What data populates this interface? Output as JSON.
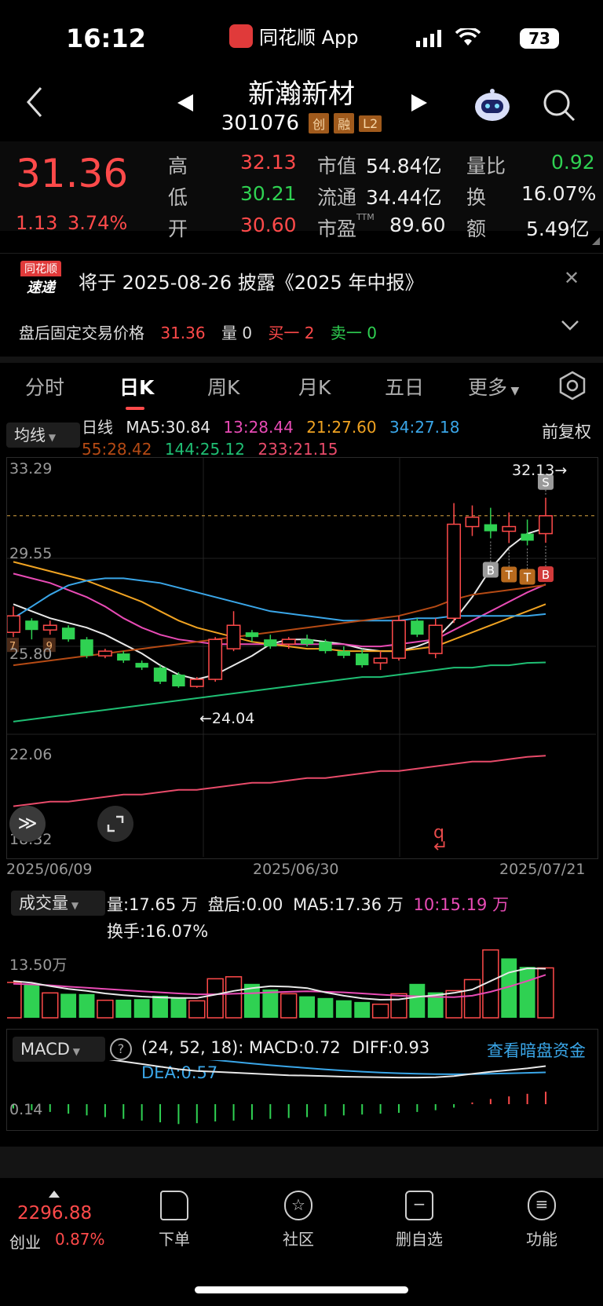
{
  "status": {
    "time": "16:12",
    "app_name": "同花顺 App",
    "battery": "73"
  },
  "header": {
    "name": "新瀚新材",
    "code": "301076",
    "tags": [
      "创",
      "融",
      "L2"
    ]
  },
  "quote": {
    "price": "31.36",
    "change": "1.13",
    "change_pct": "3.74%",
    "high_label": "高",
    "high": "32.13",
    "low_label": "低",
    "low": "30.21",
    "open_label": "开",
    "open": "30.60",
    "mcap_label": "市值",
    "mcap": "54.84亿",
    "float_label": "流通",
    "float": "34.44亿",
    "pe_label": "市盈",
    "pe_sup": "TTM",
    "pe": "89.60",
    "vr_label": "量比",
    "vr": "0.92",
    "turnover_label": "换",
    "turnover": "16.07%",
    "amount_label": "额",
    "amount": "5.49亿"
  },
  "news": {
    "badge_top": "同花顺",
    "badge_bottom": "速递",
    "text": "将于 2025-08-26 披露《2025 年中报》"
  },
  "afterhours": {
    "label": "盘后固定交易价格",
    "price": "31.36",
    "vol_label": "量",
    "vol": "0",
    "buy_label": "买一",
    "buy": "2",
    "sell_label": "卖一",
    "sell": "0"
  },
  "tabs": [
    "分时",
    "日K",
    "周K",
    "月K",
    "五日",
    "更多"
  ],
  "ma_bar": {
    "selector": "均线",
    "line_type": "日线",
    "adjust": "前复权",
    "ma": [
      {
        "label": "MA5:30.84",
        "color": "#e8e8e8"
      },
      {
        "label": "13:28.44",
        "color": "#e84bb5"
      },
      {
        "label": "21:27.60",
        "color": "#f0a322"
      },
      {
        "label": "34:27.18",
        "color": "#3aa6e8"
      },
      {
        "label": "55:28.42",
        "color": "#b54a14"
      },
      {
        "label": "144:25.12",
        "color": "#1fbf74"
      },
      {
        "label": "233:21.15",
        "color": "#e84b6a"
      }
    ]
  },
  "chart_data": [
    {
      "type": "candlestick",
      "title": "日K",
      "y_ticks": [
        "33.29",
        "29.55",
        "25.80",
        "22.06",
        "18.32"
      ],
      "ylim": [
        18.32,
        33.29
      ],
      "x_labels": [
        "2025/06/09",
        "2025/06/30",
        "2025/07/21"
      ],
      "annotations": {
        "high": "32.13→",
        "low": "←24.04",
        "dashed_price": 31.36
      },
      "candles": [
        {
          "o": 26.4,
          "c": 27.1,
          "h": 27.5,
          "l": 26.2
        },
        {
          "o": 26.9,
          "c": 26.5,
          "h": 27.0,
          "l": 26.1
        },
        {
          "o": 26.5,
          "c": 26.7,
          "h": 26.9,
          "l": 26.3
        },
        {
          "o": 26.6,
          "c": 26.1,
          "h": 26.7,
          "l": 26.0
        },
        {
          "o": 26.1,
          "c": 25.4,
          "h": 26.2,
          "l": 25.3
        },
        {
          "o": 25.4,
          "c": 25.6,
          "h": 25.7,
          "l": 25.3
        },
        {
          "o": 25.5,
          "c": 25.2,
          "h": 25.6,
          "l": 25.1
        },
        {
          "o": 25.1,
          "c": 24.9,
          "h": 25.2,
          "l": 24.8
        },
        {
          "o": 24.9,
          "c": 24.3,
          "h": 25.0,
          "l": 24.2
        },
        {
          "o": 24.6,
          "c": 24.1,
          "h": 24.7,
          "l": 24.04
        },
        {
          "o": 24.1,
          "c": 24.4,
          "h": 24.5,
          "l": 24.04
        },
        {
          "o": 24.4,
          "c": 26.1,
          "h": 26.2,
          "l": 24.3
        },
        {
          "o": 25.7,
          "c": 26.7,
          "h": 27.3,
          "l": 25.6
        },
        {
          "o": 26.4,
          "c": 26.2,
          "h": 26.5,
          "l": 26.0
        },
        {
          "o": 26.1,
          "c": 25.8,
          "h": 26.3,
          "l": 25.7
        },
        {
          "o": 25.9,
          "c": 26.1,
          "h": 26.2,
          "l": 25.7
        },
        {
          "o": 26.1,
          "c": 25.9,
          "h": 26.3,
          "l": 25.8
        },
        {
          "o": 26.0,
          "c": 25.6,
          "h": 26.1,
          "l": 25.5
        },
        {
          "o": 25.6,
          "c": 25.4,
          "h": 25.8,
          "l": 25.3
        },
        {
          "o": 25.5,
          "c": 25.0,
          "h": 25.7,
          "l": 24.9
        },
        {
          "o": 25.1,
          "c": 25.3,
          "h": 25.6,
          "l": 24.8
        },
        {
          "o": 25.3,
          "c": 26.9,
          "h": 27.1,
          "l": 25.2
        },
        {
          "o": 26.9,
          "c": 26.3,
          "h": 27.0,
          "l": 26.2
        },
        {
          "o": 25.5,
          "c": 26.7,
          "h": 27.0,
          "l": 25.3
        },
        {
          "o": 27.0,
          "c": 31.0,
          "h": 31.9,
          "l": 26.8
        },
        {
          "o": 30.9,
          "c": 31.3,
          "h": 31.8,
          "l": 30.5
        },
        {
          "o": 31.0,
          "c": 30.7,
          "h": 31.7,
          "l": 30.4
        },
        {
          "o": 30.7,
          "c": 30.9,
          "h": 31.5,
          "l": 30.2
        },
        {
          "o": 30.6,
          "c": 30.3,
          "h": 31.2,
          "l": 30.1
        },
        {
          "o": 30.6,
          "c": 31.36,
          "h": 32.13,
          "l": 30.21
        }
      ],
      "ma_lines": {
        "ma5": {
          "color": "#e8e8e8",
          "values": [
            27.6,
            27.3,
            27.0,
            26.8,
            26.6,
            26.3,
            25.9,
            25.5,
            25.0,
            24.6,
            24.4,
            24.6,
            25.0,
            25.4,
            25.9,
            26.1,
            26.1,
            26.0,
            25.9,
            25.7,
            25.6,
            25.6,
            25.8,
            26.1,
            26.9,
            27.9,
            29.1,
            30.0,
            30.6,
            30.84
          ]
        },
        "ma13": {
          "color": "#e84bb5",
          "values": [
            28.9,
            28.7,
            28.5,
            28.2,
            27.9,
            27.5,
            27.0,
            26.6,
            26.3,
            26.1,
            26.0,
            25.9,
            25.9,
            25.9,
            25.9,
            25.9,
            25.9,
            25.9,
            25.9,
            25.8,
            25.8,
            25.9,
            26.0,
            26.1,
            26.5,
            26.9,
            27.3,
            27.7,
            28.1,
            28.44
          ]
        },
        "ma21": {
          "color": "#f0a322",
          "values": [
            29.4,
            29.2,
            29.0,
            28.8,
            28.6,
            28.3,
            28.0,
            27.7,
            27.3,
            26.9,
            26.6,
            26.4,
            26.2,
            26.0,
            25.9,
            25.8,
            25.7,
            25.7,
            25.6,
            25.6,
            25.6,
            25.6,
            25.7,
            25.8,
            26.1,
            26.4,
            26.7,
            27.0,
            27.3,
            27.6
          ]
        },
        "ma34": {
          "color": "#3aa6e8",
          "values": [
            27.0,
            27.5,
            28.0,
            28.4,
            28.6,
            28.7,
            28.7,
            28.6,
            28.5,
            28.3,
            28.1,
            27.9,
            27.7,
            27.5,
            27.3,
            27.2,
            27.1,
            27.0,
            26.9,
            26.9,
            26.9,
            26.9,
            27.0,
            27.0,
            27.1,
            27.1,
            27.1,
            27.1,
            27.1,
            27.18
          ]
        },
        "ma55": {
          "color": "#b54a14",
          "values": [
            25.0,
            25.1,
            25.2,
            25.3,
            25.4,
            25.5,
            25.6,
            25.7,
            25.8,
            25.9,
            26.0,
            26.1,
            26.2,
            26.3,
            26.4,
            26.5,
            26.6,
            26.7,
            26.8,
            26.9,
            27.0,
            27.1,
            27.3,
            27.5,
            27.8,
            28.0,
            28.1,
            28.2,
            28.3,
            28.42
          ]
        },
        "ma144": {
          "color": "#1fbf74",
          "values": [
            22.6,
            22.7,
            22.8,
            22.9,
            23.0,
            23.1,
            23.2,
            23.3,
            23.4,
            23.5,
            23.6,
            23.7,
            23.8,
            23.9,
            24.0,
            24.1,
            24.2,
            24.3,
            24.4,
            24.5,
            24.5,
            24.6,
            24.7,
            24.8,
            24.9,
            24.9,
            25.0,
            25.0,
            25.1,
            25.12
          ]
        },
        "ma233": {
          "color": "#e84b6a",
          "values": [
            19.0,
            19.1,
            19.2,
            19.2,
            19.3,
            19.4,
            19.5,
            19.5,
            19.6,
            19.7,
            19.7,
            19.8,
            19.9,
            20.0,
            20.0,
            20.1,
            20.2,
            20.2,
            20.3,
            20.4,
            20.5,
            20.5,
            20.6,
            20.7,
            20.8,
            20.9,
            20.9,
            21.0,
            21.1,
            21.15
          ]
        }
      },
      "signals": [
        {
          "i": 26,
          "label": "B",
          "color": "#9a9a9a"
        },
        {
          "i": 27,
          "label": "T",
          "color": "#b86a1e"
        },
        {
          "i": 28,
          "label": "T",
          "color": "#b86a1e"
        },
        {
          "i": 29,
          "label": "B",
          "color": "#d23a3a"
        },
        {
          "i": 29,
          "label": "S",
          "color": "#9a9a9a",
          "above": true
        }
      ],
      "left_markers": [
        "7",
        "9"
      ]
    },
    {
      "type": "bar",
      "title": "成交量",
      "info": {
        "vol": "量:17.65 万",
        "after": "盘后:0.00",
        "ma5": "MA5:17.36 万",
        "ma10": "10:15.19 万",
        "turnover": "换手:16.07%"
      },
      "y_ticks": [
        "13.50万"
      ],
      "values": [
        12.5,
        12.0,
        8.8,
        8.5,
        8.4,
        6.2,
        6.4,
        6.6,
        7.8,
        7.2,
        6.0,
        13.8,
        14.5,
        12.0,
        10.0,
        8.5,
        7.6,
        7.0,
        6.2,
        5.6,
        4.8,
        8.5,
        12.0,
        9.0,
        9.6,
        13.5,
        24.0,
        21.0,
        18.0,
        17.65
      ],
      "up": [
        true,
        false,
        true,
        false,
        false,
        true,
        false,
        false,
        false,
        false,
        true,
        true,
        true,
        false,
        false,
        true,
        false,
        false,
        false,
        false,
        true,
        true,
        false,
        false,
        true,
        true,
        true,
        false,
        false,
        true
      ],
      "ma5": [
        13.0,
        12.4,
        11.2,
        10.2,
        9.5,
        8.6,
        8.0,
        7.5,
        7.2,
        7.0,
        7.0,
        8.2,
        9.5,
        10.5,
        11.2,
        11.0,
        10.5,
        9.0,
        7.8,
        6.9,
        6.4,
        6.5,
        7.4,
        8.0,
        8.8,
        10.0,
        13.0,
        16.0,
        17.5,
        17.36
      ],
      "ma10": [
        12.0,
        11.8,
        11.5,
        11.0,
        10.6,
        10.2,
        9.8,
        9.4,
        9.0,
        8.6,
        8.3,
        8.3,
        8.5,
        8.7,
        9.0,
        9.2,
        9.4,
        9.2,
        9.0,
        8.6,
        8.2,
        7.8,
        7.6,
        7.4,
        7.3,
        7.8,
        9.2,
        11.0,
        13.0,
        15.19
      ]
    },
    {
      "type": "macd",
      "title": "MACD",
      "params": "(24, 52, 18): MACD:0.72",
      "diff": "DIFF:0.93",
      "dea": "DEA:0.57",
      "y_ticks": [
        "0.14"
      ],
      "hist": [
        -0.25,
        -0.35,
        -0.45,
        -0.55,
        -0.65,
        -0.75,
        -0.85,
        -0.95,
        -1.05,
        -1.15,
        -1.1,
        -1.0,
        -0.95,
        -0.9,
        -0.85,
        -0.8,
        -0.75,
        -0.7,
        -0.65,
        -0.6,
        -0.55,
        -0.5,
        -0.45,
        -0.35,
        -0.2,
        0.1,
        0.3,
        0.45,
        0.6,
        0.72
      ],
      "diff_line": [
        1.8,
        1.75,
        1.7,
        1.6,
        1.5,
        1.35,
        1.2,
        1.05,
        0.9,
        0.75,
        0.65,
        0.6,
        0.55,
        0.5,
        0.45,
        0.4,
        0.38,
        0.35,
        0.32,
        0.3,
        0.28,
        0.27,
        0.27,
        0.28,
        0.35,
        0.48,
        0.6,
        0.7,
        0.8,
        0.93
      ],
      "dea_line": [
        1.95,
        1.92,
        1.9,
        1.87,
        1.83,
        1.78,
        1.72,
        1.65,
        1.57,
        1.48,
        1.38,
        1.28,
        1.18,
        1.08,
        0.98,
        0.9,
        0.82,
        0.74,
        0.67,
        0.61,
        0.56,
        0.52,
        0.49,
        0.47,
        0.46,
        0.47,
        0.49,
        0.51,
        0.54,
        0.57
      ]
    }
  ],
  "dark_funds_link": "查看暗盘资金",
  "bottom": {
    "index_value": "2296.88",
    "index_name": "创业",
    "index_pct": "0.87%",
    "nav": [
      "下单",
      "社区",
      "删自选",
      "功能"
    ]
  }
}
